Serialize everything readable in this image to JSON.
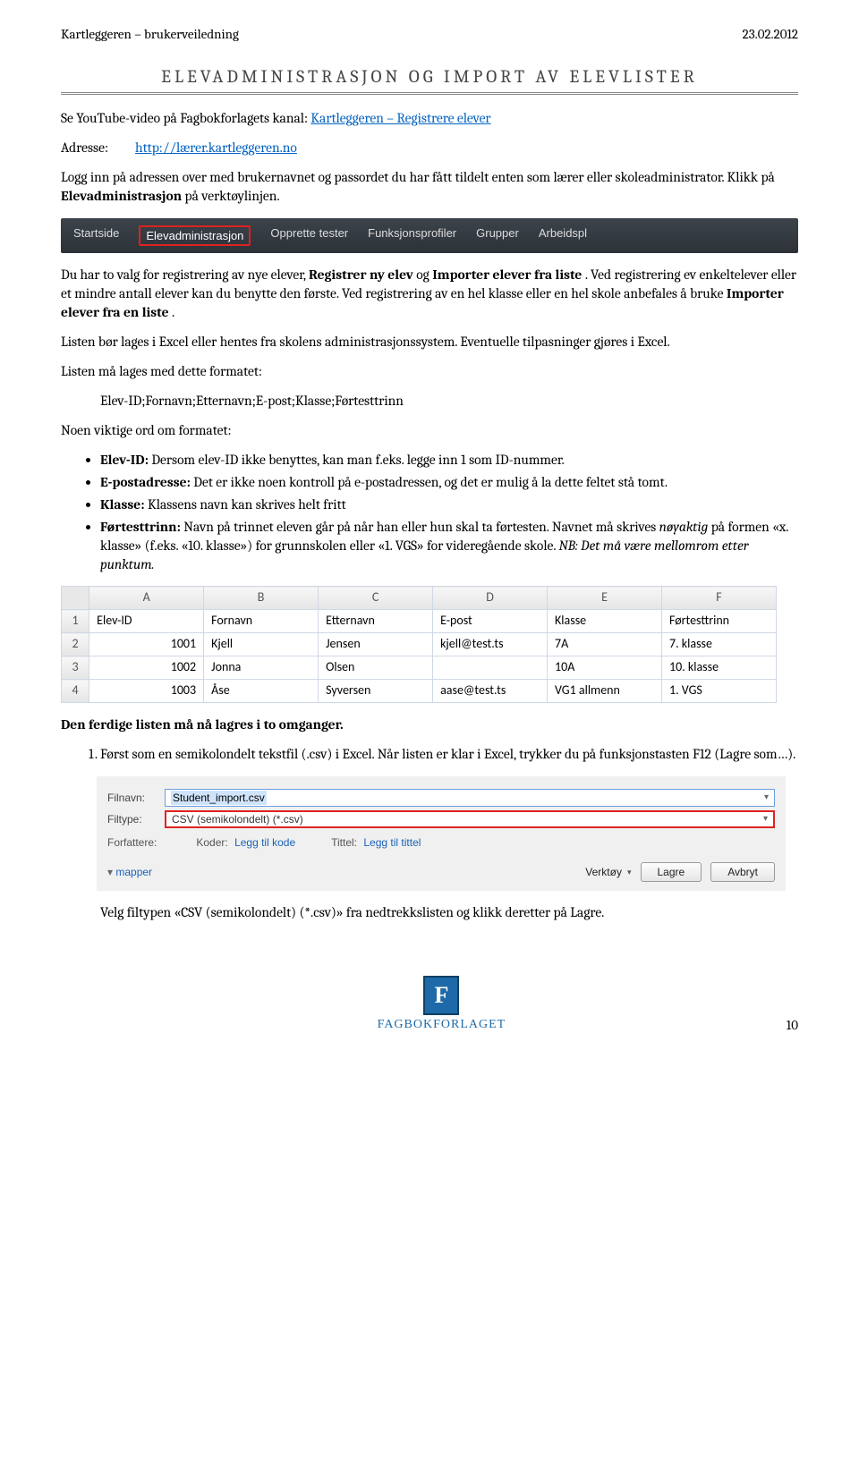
{
  "header": {
    "left": "Kartleggeren – brukerveiledning",
    "right": "23.02.2012"
  },
  "title": "ELEVADMINISTRASJON OG IMPORT AV ELEVLISTER",
  "intro": {
    "line1_pre": "Se YouTube-video på Fagbokforlagets kanal: ",
    "line1_link": "Kartleggeren – Registrere elever",
    "addr_label": "Adresse:",
    "addr_link": "http://lærer.kartleggeren.no",
    "p2a": "Logg inn på adressen over med brukernavnet og passordet du har fått tildelt enten som lærer eller skoleadministrator. Klikk på ",
    "p2b": "Elevadministrasjon",
    "p2c": " på verktøylinjen."
  },
  "navbar": {
    "items": [
      "Startside",
      "Elevadministrasjon",
      "Opprette tester",
      "Funksjonsprofiler",
      "Grupper",
      "Arbeidspl"
    ],
    "active_index": 1
  },
  "body": {
    "p3a": "Du har to valg for registrering av nye elever, ",
    "p3b": "Registrer ny elev",
    "p3c": " og ",
    "p3d": "Importer elever fra liste",
    "p3e": ". Ved registrering ev enkeltelever eller et mindre antall elever kan du benytte den første. Ved registrering av en hel klasse eller en hel skole anbefales å bruke ",
    "p3f": "Importer elever fra en liste",
    "p3g": ".",
    "p4": "Listen bør lages i Excel eller hentes fra skolens administrasjonssystem. Eventuelle tilpasninger gjøres i Excel.",
    "p5": "Listen må lages med dette formatet:",
    "format": "Elev-ID;Fornavn;Etternavn;E-post;Klasse;Førtesttrinn",
    "p6": "Noen viktige ord om formatet:"
  },
  "bullets": {
    "b1a": "Elev-ID:",
    "b1b": " Dersom elev-ID ikke benyttes, kan man f.eks. legge inn 1 som ID-nummer.",
    "b2a": "E-postadresse:",
    "b2b": " Det er ikke noen kontroll på e-postadressen, og det er mulig å la dette feltet stå tomt.",
    "b3a": "Klasse:",
    "b3b": " Klassens navn kan skrives helt fritt",
    "b4a": "Førtesttrinn:",
    "b4b": " Navn på trinnet eleven går på når han eller hun skal ta førtesten. Navnet må skrives ",
    "b4c": "nøyaktig",
    "b4d": " på formen «x. klasse» (f.eks. «10. klasse») for grunnskolen eller «1. VGS» for videregående skole. ",
    "b4e": "NB: Det må være mellomrom etter punktum."
  },
  "table": {
    "cols": [
      "A",
      "B",
      "C",
      "D",
      "E",
      "F"
    ],
    "rows": [
      [
        "1",
        "Elev-ID",
        "Fornavn",
        "Etternavn",
        "E-post",
        "Klasse",
        "Førtesttrinn"
      ],
      [
        "2",
        "1001",
        "Kjell",
        "Jensen",
        "kjell@test.ts",
        "7A",
        "7. klasse"
      ],
      [
        "3",
        "1002",
        "Jonna",
        "Olsen",
        "",
        "10A",
        "10. klasse"
      ],
      [
        "4",
        "1003",
        "Åse",
        "Syversen",
        "aase@test.ts",
        "VG1 allmenn",
        "1. VGS"
      ]
    ]
  },
  "save_heading": "Den ferdige listen må nå lagres i to omganger.",
  "steps": {
    "s1": "Først som en semikolondelt tekstfil (.csv) i Excel. Når listen er klar i Excel, trykker du på funksjonstasten F12 (Lagre som…)."
  },
  "savebox": {
    "filnavn_label": "Filnavn:",
    "filnavn_value": "Student_import.csv",
    "filtype_label": "Filtype:",
    "filtype_value": "CSV (semikolondelt) (*.csv)",
    "forfattere": "Forfattere:",
    "koder_lbl": "Koder:",
    "koder_val": "Legg til kode",
    "tittel_lbl": "Tittel:",
    "tittel_val": "Legg til tittel",
    "mapper": "mapper",
    "verktoy": "Verktøy",
    "lagre": "Lagre",
    "avbryt": "Avbryt"
  },
  "p_after": "Velg filtypen «CSV (semikolondelt) (*.csv)» fra nedtrekkslisten og klikk deretter på Lagre.",
  "footer": {
    "logo_letter": "F",
    "logo_text": "FAGBOKFORLAGET",
    "page": "10"
  }
}
